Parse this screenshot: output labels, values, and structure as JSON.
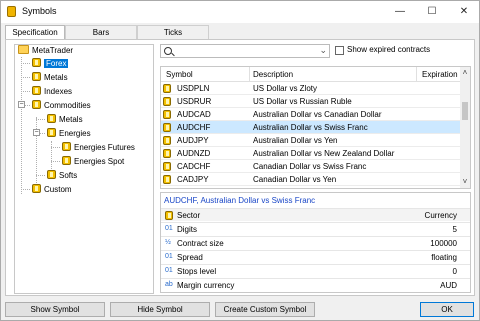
{
  "window": {
    "title": "Symbols",
    "minimize": "—",
    "maximize": "☐",
    "close": "✕"
  },
  "tabs": [
    {
      "label": "Specification",
      "active": true
    },
    {
      "label": "Bars",
      "active": false
    },
    {
      "label": "Ticks",
      "active": false
    }
  ],
  "tree": {
    "root": "MetaTrader",
    "nodes": [
      {
        "label": "Forex",
        "selected": true
      },
      {
        "label": "Metals"
      },
      {
        "label": "Indexes"
      },
      {
        "label": "Commodities",
        "expanded": true
      },
      {
        "label": "Metals"
      },
      {
        "label": "Energies",
        "expanded": true
      },
      {
        "label": "Energies Futures"
      },
      {
        "label": "Energies Spot"
      },
      {
        "label": "Softs"
      },
      {
        "label": "Custom"
      }
    ]
  },
  "search": {
    "value": "",
    "placeholder": ""
  },
  "show_expired": {
    "label": "Show expired contracts",
    "checked": false
  },
  "grid": {
    "columns": [
      "Symbol",
      "Description",
      "Expiration"
    ],
    "rows": [
      {
        "symbol": "USDPLN",
        "description": "US Dollar vs Zloty",
        "expiration": ""
      },
      {
        "symbol": "USDRUR",
        "description": "US Dollar vs Russian Ruble",
        "expiration": ""
      },
      {
        "symbol": "AUDCAD",
        "description": "Australian Dollar vs Canadian Dollar",
        "expiration": ""
      },
      {
        "symbol": "AUDCHF",
        "description": "Australian Dollar vs Swiss Franc",
        "expiration": "",
        "selected": true
      },
      {
        "symbol": "AUDJPY",
        "description": "Australian Dollar vs Yen",
        "expiration": ""
      },
      {
        "symbol": "AUDNZD",
        "description": "Australian Dollar vs New Zealand Dollar",
        "expiration": ""
      },
      {
        "symbol": "CADCHF",
        "description": "Canadian Dollar vs Swiss Franc",
        "expiration": ""
      },
      {
        "symbol": "CADJPY",
        "description": "Canadian Dollar vs Yen",
        "expiration": ""
      }
    ]
  },
  "properties": {
    "title": "AUDCHF, Australian Dollar vs Swiss Franc",
    "rows": [
      {
        "icon": "coin-icon",
        "glyph": "",
        "label": "Sector",
        "value": "Currency"
      },
      {
        "icon": "number-icon",
        "glyph": "01",
        "label": "Digits",
        "value": "5"
      },
      {
        "icon": "fraction-icon",
        "glyph": "½",
        "label": "Contract size",
        "value": "100000"
      },
      {
        "icon": "number-icon",
        "glyph": "01",
        "label": "Spread",
        "value": "floating"
      },
      {
        "icon": "number-icon",
        "glyph": "01",
        "label": "Stops level",
        "value": "0"
      },
      {
        "icon": "text-icon",
        "glyph": "ab",
        "label": "Margin currency",
        "value": "AUD"
      }
    ]
  },
  "buttons": {
    "show_symbol": "Show Symbol",
    "hide_symbol": "Hide Symbol",
    "create_custom": "Create Custom Symbol",
    "ok": "OK"
  },
  "colors": {
    "accent": "#0078d7",
    "row_selected": "#cce8ff",
    "title_blue": "#1a47c7",
    "coin": "#f4c000"
  }
}
